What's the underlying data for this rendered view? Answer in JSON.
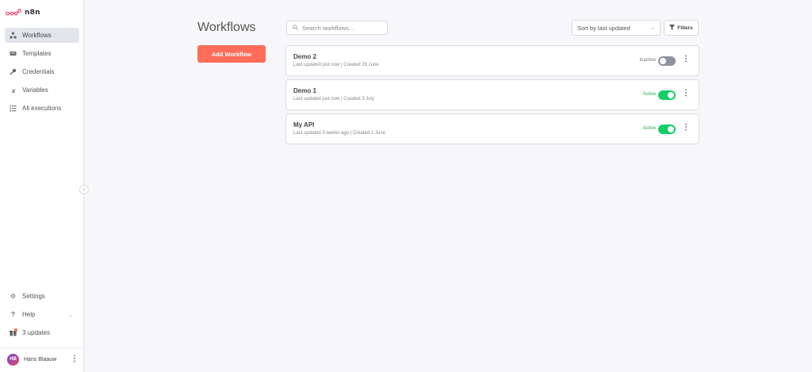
{
  "app": {
    "logo_text": "n8n"
  },
  "sidebar": {
    "items": [
      {
        "label": "Workflows",
        "icon": "workflows-icon",
        "active": true
      },
      {
        "label": "Templates",
        "icon": "templates-icon"
      },
      {
        "label": "Credentials",
        "icon": "key-icon"
      },
      {
        "label": "Variables",
        "icon": "variables-icon"
      },
      {
        "label": "All executions",
        "icon": "executions-icon"
      }
    ],
    "bottom": {
      "settings": "Settings",
      "help": "Help",
      "updates": "3 updates"
    },
    "user": {
      "initials": "HB",
      "name": "Hans Blaauw"
    }
  },
  "main": {
    "title": "Workflows",
    "add_button": "Add Workflow",
    "search_placeholder": "Search workflows...",
    "sort_value": "Sort by last updated",
    "filters_label": "Filters"
  },
  "workflows": [
    {
      "name": "Demo 2",
      "meta": "Last updated just now | Created 28 June",
      "status": "Inactive",
      "active": false
    },
    {
      "name": "Demo 1",
      "meta": "Last updated just now | Created 3 July",
      "status": "Active",
      "active": true
    },
    {
      "name": "My API",
      "meta": "Last updated 3 weeks ago | Created 1 June",
      "status": "Active",
      "active": true
    }
  ],
  "colors": {
    "accent": "#ff6d5a",
    "active_toggle": "#13ce66",
    "inactive_toggle": "#8d939e"
  }
}
